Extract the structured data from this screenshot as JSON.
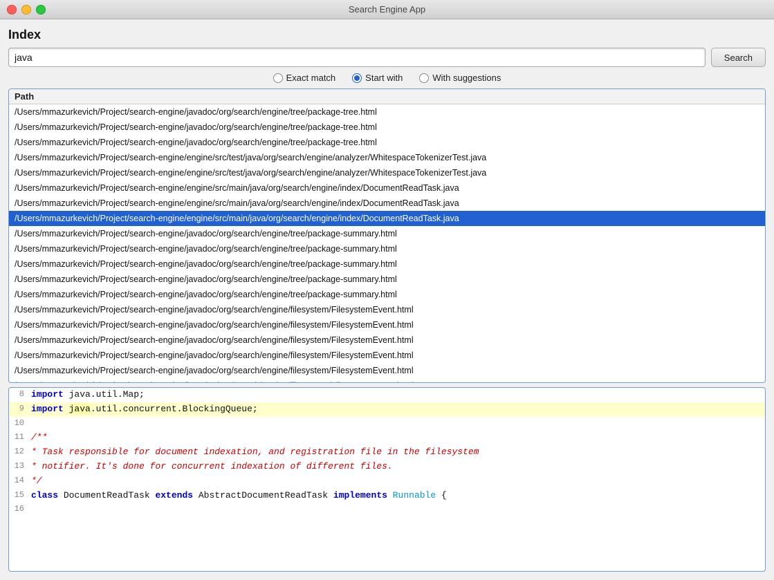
{
  "window": {
    "title": "Search Engine App"
  },
  "header": {
    "index_label": "Index"
  },
  "toolbar": {
    "search_value": "java",
    "search_placeholder": "",
    "search_button_label": "Search"
  },
  "radio_options": [
    {
      "id": "exact",
      "label": "Exact match",
      "selected": false
    },
    {
      "id": "start",
      "label": "Start with",
      "selected": true
    },
    {
      "id": "suggest",
      "label": "With suggestions",
      "selected": false
    }
  ],
  "results": {
    "column_header": "Path",
    "rows": [
      {
        "path": "/Users/mmazurkevich/Project/search-engine/javadoc/org/search/engine/tree/package-tree.html",
        "selected": false
      },
      {
        "path": "/Users/mmazurkevich/Project/search-engine/javadoc/org/search/engine/tree/package-tree.html",
        "selected": false
      },
      {
        "path": "/Users/mmazurkevich/Project/search-engine/javadoc/org/search/engine/tree/package-tree.html",
        "selected": false
      },
      {
        "path": "/Users/mmazurkevich/Project/search-engine/engine/src/test/java/org/search/engine/analyzer/WhitespaceTokenizerTest.java",
        "selected": false
      },
      {
        "path": "/Users/mmazurkevich/Project/search-engine/engine/src/test/java/org/search/engine/analyzer/WhitespaceTokenizerTest.java",
        "selected": false
      },
      {
        "path": "/Users/mmazurkevich/Project/search-engine/engine/src/main/java/org/search/engine/index/DocumentReadTask.java",
        "selected": false
      },
      {
        "path": "/Users/mmazurkevich/Project/search-engine/engine/src/main/java/org/search/engine/index/DocumentReadTask.java",
        "selected": false
      },
      {
        "path": "/Users/mmazurkevich/Project/search-engine/engine/src/main/java/org/search/engine/index/DocumentReadTask.java",
        "selected": true
      },
      {
        "path": "/Users/mmazurkevich/Project/search-engine/javadoc/org/search/engine/tree/package-summary.html",
        "selected": false
      },
      {
        "path": "/Users/mmazurkevich/Project/search-engine/javadoc/org/search/engine/tree/package-summary.html",
        "selected": false
      },
      {
        "path": "/Users/mmazurkevich/Project/search-engine/javadoc/org/search/engine/tree/package-summary.html",
        "selected": false
      },
      {
        "path": "/Users/mmazurkevich/Project/search-engine/javadoc/org/search/engine/tree/package-summary.html",
        "selected": false
      },
      {
        "path": "/Users/mmazurkevich/Project/search-engine/javadoc/org/search/engine/tree/package-summary.html",
        "selected": false
      },
      {
        "path": "/Users/mmazurkevich/Project/search-engine/javadoc/org/search/engine/filesystem/FilesystemEvent.html",
        "selected": false
      },
      {
        "path": "/Users/mmazurkevich/Project/search-engine/javadoc/org/search/engine/filesystem/FilesystemEvent.html",
        "selected": false
      },
      {
        "path": "/Users/mmazurkevich/Project/search-engine/javadoc/org/search/engine/filesystem/FilesystemEvent.html",
        "selected": false
      },
      {
        "path": "/Users/mmazurkevich/Project/search-engine/javadoc/org/search/engine/filesystem/FilesystemEvent.html",
        "selected": false
      },
      {
        "path": "/Users/mmazurkevich/Project/search-engine/javadoc/org/search/engine/filesystem/FilesystemEvent.html",
        "selected": false
      },
      {
        "path": "/Users/mmazurkevich/Project/search-engine/javadoc/org/search/engine/filesystem/FilesystemEvent.html",
        "selected": false
      }
    ]
  },
  "code": {
    "lines": [
      {
        "number": 8,
        "content": "import java.util.Map;",
        "highlighted": false,
        "tokens": [
          {
            "type": "kw",
            "text": "import"
          },
          {
            "type": "normal",
            "text": " java.util.Map;"
          }
        ]
      },
      {
        "number": 9,
        "content": "import java.util.concurrent.BlockingQueue;",
        "highlighted": true,
        "tokens": [
          {
            "type": "kw",
            "text": "import"
          },
          {
            "type": "normal",
            "text": " "
          },
          {
            "type": "highlight",
            "text": "java"
          },
          {
            "type": "normal",
            "text": ".util.concurrent.BlockingQueue;"
          }
        ]
      },
      {
        "number": 10,
        "content": "",
        "highlighted": false,
        "tokens": []
      },
      {
        "number": 11,
        "content": "/**",
        "highlighted": false,
        "tokens": [
          {
            "type": "comment",
            "text": "/**"
          }
        ]
      },
      {
        "number": 12,
        "content": " * Task responsible for document indexation, and registration file in the filesystem",
        "highlighted": false,
        "tokens": [
          {
            "type": "comment",
            "text": " * Task responsible for document indexation, and registration file in the filesystem"
          }
        ]
      },
      {
        "number": 13,
        "content": " * notifier. It's done for concurrent indexation of different files.",
        "highlighted": false,
        "tokens": [
          {
            "type": "comment",
            "text": " * notifier. It's done for concurrent indexation of different files."
          }
        ]
      },
      {
        "number": 14,
        "content": " */",
        "highlighted": false,
        "tokens": [
          {
            "type": "comment",
            "text": " */"
          }
        ]
      },
      {
        "number": 15,
        "content": "class DocumentReadTask extends AbstractDocumentReadTask implements Runnable {",
        "highlighted": false,
        "tokens": [
          {
            "type": "kw",
            "text": "class"
          },
          {
            "type": "normal",
            "text": " DocumentReadTask "
          },
          {
            "type": "kw",
            "text": "extends"
          },
          {
            "type": "normal",
            "text": " AbstractDocumentReadTask "
          },
          {
            "type": "kw",
            "text": "implements"
          },
          {
            "type": "normal",
            "text": " "
          },
          {
            "type": "type",
            "text": "Runnable"
          },
          {
            "type": "normal",
            "text": " {"
          }
        ]
      },
      {
        "number": 16,
        "content": "",
        "highlighted": false,
        "tokens": []
      }
    ]
  }
}
